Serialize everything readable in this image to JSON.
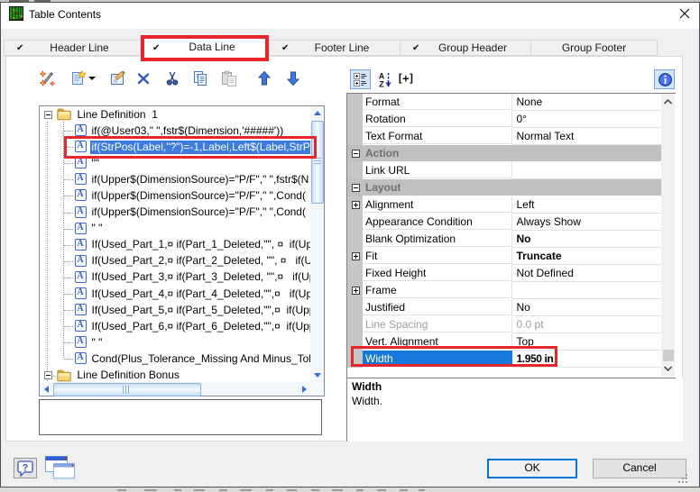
{
  "colors": {
    "accent": "#0078d7",
    "tree-sel": "#3d7be0",
    "grid-sel": "#1678da",
    "annotation": "#e8252a"
  },
  "window": {
    "title": "Table Contents"
  },
  "tabs": [
    {
      "id": "header-line",
      "label": "Header Line",
      "checked": true,
      "selected": false
    },
    {
      "id": "data-line",
      "label": "Data Line",
      "checked": true,
      "selected": true,
      "annotated": true
    },
    {
      "id": "footer-line",
      "label": "Footer Line",
      "checked": true,
      "selected": false
    },
    {
      "id": "group-header",
      "label": "Group Header",
      "checked": true,
      "selected": false
    },
    {
      "id": "group-footer",
      "label": "Group Footer",
      "checked": false,
      "selected": false
    }
  ],
  "line_toolbar": [
    {
      "name": "formula-wizard",
      "icon": "wand"
    },
    {
      "name": "new-line",
      "icon": "new",
      "dropdown": true
    },
    {
      "name": "edit-line",
      "icon": "edit"
    },
    {
      "name": "delete-line",
      "icon": "delete"
    },
    {
      "name": "cut",
      "icon": "cut"
    },
    {
      "name": "copy",
      "icon": "copy"
    },
    {
      "name": "paste",
      "icon": "paste",
      "disabled": true
    },
    {
      "name": "move-up",
      "icon": "arrow-up"
    },
    {
      "name": "move-down",
      "icon": "arrow-down"
    }
  ],
  "tree": {
    "items": [
      {
        "type": "folder",
        "label": "Line Definition  1",
        "expanded": true
      },
      {
        "type": "formula",
        "label": "if(@User03,\" \",fstr$(Dimension,'#####'))"
      },
      {
        "type": "formula",
        "label": "if(StrPos(Label,\"?\")=-1,Label,Left$(Label,StrPo",
        "selected": true,
        "annotated": true
      },
      {
        "type": "formula",
        "label": "\"\""
      },
      {
        "type": "formula",
        "label": "if(Upper$(DimensionSource)=\"P/F\",\" \",fstr$(N"
      },
      {
        "type": "formula",
        "label": "if(Upper$(DimensionSource)=\"P/F\",\" \",Cond("
      },
      {
        "type": "formula",
        "label": "if(Upper$(DimensionSource)=\"P/F\",\" \",Cond("
      },
      {
        "type": "formula",
        "label": "\" \""
      },
      {
        "type": "formula",
        "label": "If(Used_Part_1,¤ if(Part_1_Deleted,\"\", ¤  if(Upp"
      },
      {
        "type": "formula",
        "label": "If(Used_Part_2,¤ if(Part_2_Deleted, \"\", ¤   if(Up"
      },
      {
        "type": "formula",
        "label": "If(Used_Part_3,¤ if(Part_3_Deleted, \"\",¤   if(Upp"
      },
      {
        "type": "formula",
        "label": "If(Used_Part_4,¤ if(Part_4_Deleted,\"\",¤   if(Upp"
      },
      {
        "type": "formula",
        "label": "If(Used_Part_5,¤ if(Part_5_Deleted,\"\",¤  if(Upp"
      },
      {
        "type": "formula",
        "label": "If(Used_Part_6,¤ if(Part_6_Deleted,\"\",¤  if(Upp"
      },
      {
        "type": "formula",
        "label": "\" \""
      },
      {
        "type": "formula",
        "label": "Cond(Plus_Tolerance_Missing And Minus_Tol"
      },
      {
        "type": "folder",
        "label": "Line Definition Bonus",
        "expanded": true
      }
    ]
  },
  "grid_toolbar": [
    {
      "name": "categorized-view",
      "icon": "categorized",
      "selected": true
    },
    {
      "name": "sort-alphabetical",
      "icon": "sort-az",
      "selected": false
    },
    {
      "name": "expand-all",
      "icon": "expand-all",
      "label": "[+]",
      "selected": false
    }
  ],
  "help_toggle": {
    "name": "property-info-toggle",
    "icon": "info",
    "selected": true
  },
  "properties": {
    "rows": [
      {
        "name": "Format",
        "value": "None"
      },
      {
        "name": "Rotation",
        "value": "0°"
      },
      {
        "name": "Text Format",
        "value": "Normal Text"
      },
      {
        "name": "Action",
        "kind": "group",
        "expand": "minus"
      },
      {
        "name": "Link URL",
        "value": ""
      },
      {
        "name": "Layout",
        "kind": "group",
        "expand": "minus"
      },
      {
        "name": "Alignment",
        "value": "Left",
        "expand": "plus"
      },
      {
        "name": "Appearance Condition",
        "value": "Always Show"
      },
      {
        "name": "Blank Optimization",
        "value": "No",
        "bold": true
      },
      {
        "name": "Fit",
        "value": "Truncate",
        "bold": true,
        "expand": "plus"
      },
      {
        "name": "Fixed Height",
        "value": "Not Defined"
      },
      {
        "name": "Frame",
        "value": "",
        "expand": "plus"
      },
      {
        "name": "Justified",
        "value": "No"
      },
      {
        "name": "Line Spacing",
        "value": "0.0 pt",
        "disabled": true
      },
      {
        "name": "Vert. Alignment",
        "value": "Top"
      },
      {
        "name": "Width",
        "value": "1.950 in",
        "bold": true,
        "selected": true,
        "annotated": true
      }
    ],
    "description": {
      "title": "Width",
      "text": "Width."
    }
  },
  "buttons": {
    "help": "help",
    "windows": "windows",
    "ok": "OK",
    "cancel": "Cancel"
  }
}
